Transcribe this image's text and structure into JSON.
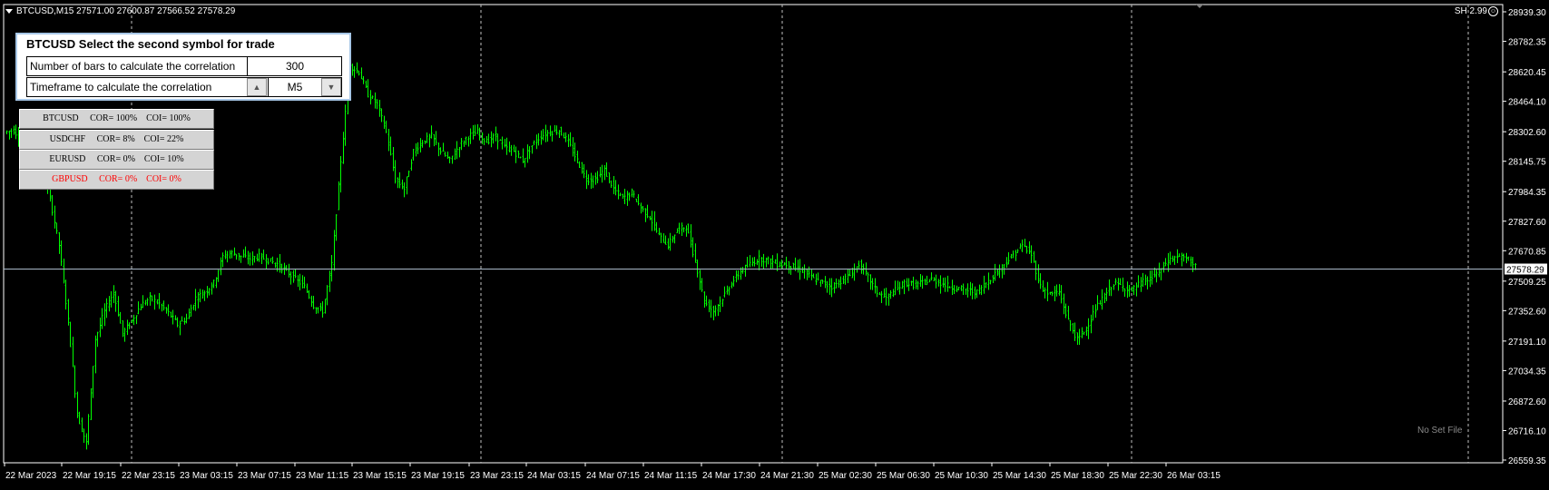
{
  "header": {
    "symbol_info": "BTCUSD,M15  27571.00 27600.87 27566.52 27578.29",
    "sh_text": "SH 2.99"
  },
  "watermark": "No Set File",
  "panel": {
    "title": "BTCUSD Select the second symbol for trade",
    "bars_label": "Number of bars to calculate the correlation",
    "bars_value": "300",
    "timeframe_label": "Timeframe to calculate the correlation",
    "timeframe_value": "M5"
  },
  "symbols": [
    {
      "text": "BTCUSD     COR= 100%    COI= 100%",
      "color": "#000000"
    },
    {
      "text": "USDCHF     COR= 8%    COI= 22%",
      "color": "#000000"
    },
    {
      "text": "EURUSD     COR= 0%    COI= 10%",
      "color": "#000000"
    },
    {
      "text": "GBPUSD     COR= 0%    COI= 0%",
      "color": "#ff0000"
    }
  ],
  "colors": {
    "background": "#000000",
    "candles": "#00ff00",
    "current_price_line": "#a9b8c8",
    "grid_separator": "#c0c0c0"
  },
  "chart_data": {
    "type": "line",
    "price_axis_labels": [
      "28939.30",
      "28782.35",
      "28620.45",
      "28464.10",
      "28302.60",
      "28145.75",
      "27984.35",
      "27827.60",
      "27670.85",
      "27509.25",
      "27352.60",
      "27191.10",
      "27034.35",
      "26872.60",
      "26716.10",
      "26559.35"
    ],
    "current_price": "27578.29",
    "time_axis_labels": [
      "22 Mar 2023",
      "22 Mar 19:15",
      "22 Mar 23:15",
      "23 Mar 03:15",
      "23 Mar 07:15",
      "23 Mar 11:15",
      "23 Mar 15:15",
      "23 Mar 19:15",
      "23 Mar 23:15",
      "24 Mar 03:15",
      "24 Mar 07:15",
      "24 Mar 11:15",
      "24 Mar 17:30",
      "24 Mar 21:30",
      "25 Mar 02:30",
      "25 Mar 06:30",
      "25 Mar 10:30",
      "25 Mar 14:30",
      "25 Mar 18:30",
      "25 Mar 22:30",
      "26 Mar 03:15"
    ],
    "series": [
      {
        "values": [
          28300,
          28310,
          28250,
          28200,
          28180,
          27950,
          27700,
          27300,
          26800,
          26650,
          27200,
          27350,
          27450,
          27230,
          27300,
          27380,
          27420,
          27390,
          27340,
          27280,
          27310,
          27420,
          27450,
          27500,
          27640,
          27660,
          27640,
          27630,
          27640,
          27620,
          27600,
          27560,
          27520,
          27480,
          27380,
          27350,
          27600,
          28150,
          28650,
          28620,
          28500,
          28450,
          28300,
          28050,
          28000,
          28200,
          28250,
          28280,
          28200,
          28150,
          28230,
          28280,
          28300,
          28250,
          28280,
          28220,
          28200,
          28150,
          28230,
          28280,
          28300,
          28310,
          28250,
          28150,
          28050,
          28050,
          28100,
          28000,
          27950,
          27980,
          27900,
          27850,
          27750,
          27700,
          27780,
          27800,
          27620,
          27400,
          27350,
          27420,
          27500,
          27560,
          27600,
          27630,
          27620,
          27600,
          27600,
          27580,
          27560,
          27520,
          27500,
          27480,
          27510,
          27540,
          27600,
          27530,
          27450,
          27420,
          27460,
          27500,
          27490,
          27500,
          27520,
          27500,
          27480,
          27470,
          27460,
          27450,
          27500,
          27550,
          27600,
          27650,
          27700,
          27650,
          27480,
          27440,
          27450,
          27300,
          27200,
          27260,
          27360,
          27430,
          27500,
          27480,
          27460,
          27500,
          27520,
          27560,
          27620,
          27640,
          27630,
          27600
        ]
      }
    ]
  }
}
